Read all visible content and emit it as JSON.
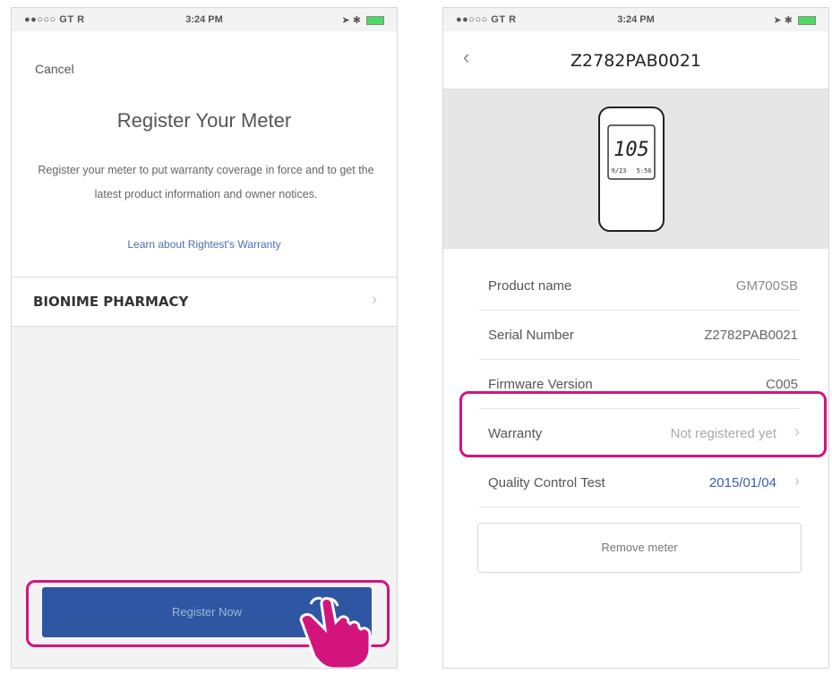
{
  "status_bar": {
    "carrier": "●●○○○ GT R",
    "time": "3:24 PM",
    "icons": [
      "wifi-icon",
      "location-icon",
      "bluetooth-icon",
      "battery-icon"
    ]
  },
  "register_screen": {
    "cancel_label": "Cancel",
    "title": "Register Your Meter",
    "description": "Register your meter to put warranty coverage in force and to get the latest product information and owner notices.",
    "warranty_link": "Learn about Rightest's Warranty",
    "store_name": "BIONIME PHARMACY",
    "register_button": "Register Now",
    "highlight_color": "#d4147d",
    "button_color": "#2e56a3"
  },
  "meter_detail_screen": {
    "title": "Z2782PAB0021",
    "meter_display": {
      "main_reading": "105",
      "small_left": "9/23",
      "small_right": "5:56"
    },
    "rows": [
      {
        "label": "Product name",
        "value": "GM700SB"
      },
      {
        "label": "Serial Number",
        "value": "Z2782PAB0021"
      },
      {
        "label": "Firmware Version",
        "value": "C005"
      },
      {
        "label": "Warranty",
        "value": "Not registered yet"
      },
      {
        "label": "Quality Control Test",
        "value": "2015/01/04"
      }
    ],
    "remove_button": "Remove meter",
    "link_color": "#3a5fa8"
  }
}
